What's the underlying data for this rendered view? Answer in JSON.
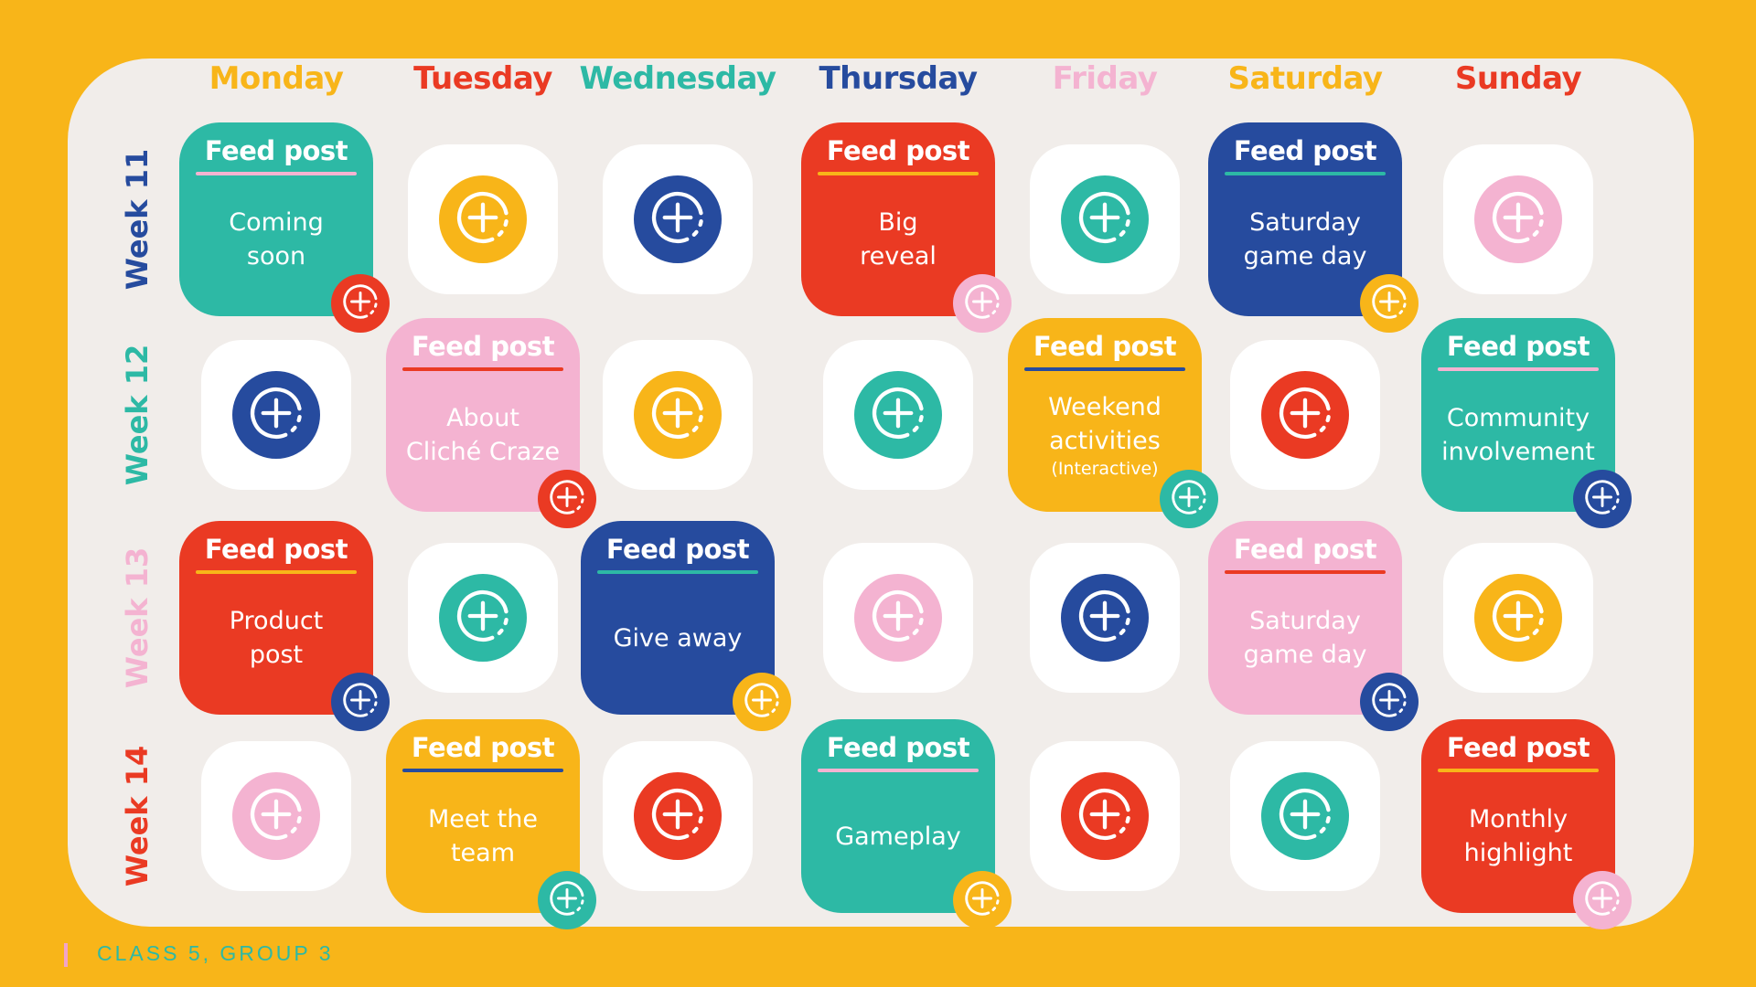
{
  "colors": {
    "yellow": "#F8B519",
    "red": "#EA3A23",
    "teal": "#2DB9A5",
    "navy": "#264B9E",
    "pink": "#F4B3D1",
    "board": "#F1EDEA"
  },
  "days": [
    {
      "label": "Monday",
      "color": "#F8B519"
    },
    {
      "label": "Tuesday",
      "color": "#EA3A23"
    },
    {
      "label": "Wednesday",
      "color": "#2DB9A5"
    },
    {
      "label": "Thursday",
      "color": "#264B9E"
    },
    {
      "label": "Friday",
      "color": "#F4B3D1"
    },
    {
      "label": "Saturday",
      "color": "#F8B519"
    },
    {
      "label": "Sunday",
      "color": "#EA3A23"
    }
  ],
  "weeks": [
    {
      "label": "Week 11",
      "color": "#264B9E"
    },
    {
      "label": "Week 12",
      "color": "#2DB9A5"
    },
    {
      "label": "Week 13",
      "color": "#F4B3D1"
    },
    {
      "label": "Week 14",
      "color": "#EA3A23"
    }
  ],
  "icon": "add-circle-icon",
  "grid": [
    [
      {
        "type": "post",
        "bg": "#2DB9A5",
        "rule": "#F4B3D1",
        "badge": "#EA3A23",
        "title": "Feed post",
        "text": "Coming\nsoon"
      },
      {
        "type": "empty",
        "circle": "#F8B519"
      },
      {
        "type": "empty",
        "circle": "#264B9E"
      },
      {
        "type": "post",
        "bg": "#EA3A23",
        "rule": "#F8B519",
        "badge": "#F4B3D1",
        "title": "Feed post",
        "text": "Big\nreveal"
      },
      {
        "type": "empty",
        "circle": "#2DB9A5"
      },
      {
        "type": "post",
        "bg": "#264B9E",
        "rule": "#2DB9A5",
        "badge": "#F8B519",
        "title": "Feed post",
        "text": "Saturday\ngame day"
      },
      {
        "type": "empty",
        "circle": "#F4B3D1"
      }
    ],
    [
      {
        "type": "empty",
        "circle": "#264B9E"
      },
      {
        "type": "post",
        "bg": "#F4B3D1",
        "rule": "#EA3A23",
        "badge": "#EA3A23",
        "title": "Feed post",
        "text": "About\nCliché Craze"
      },
      {
        "type": "empty",
        "circle": "#F8B519"
      },
      {
        "type": "empty",
        "circle": "#2DB9A5"
      },
      {
        "type": "post",
        "bg": "#F8B519",
        "rule": "#264B9E",
        "badge": "#2DB9A5",
        "title": "Feed post",
        "text": "Weekend\nactivities",
        "sub": "(Interactive)"
      },
      {
        "type": "empty",
        "circle": "#EA3A23"
      },
      {
        "type": "post",
        "bg": "#2DB9A5",
        "rule": "#F4B3D1",
        "badge": "#264B9E",
        "title": "Feed post",
        "text": "Community\ninvolvement"
      }
    ],
    [
      {
        "type": "post",
        "bg": "#EA3A23",
        "rule": "#F8B519",
        "badge": "#264B9E",
        "title": "Feed post",
        "text": "Product\npost"
      },
      {
        "type": "empty",
        "circle": "#2DB9A5"
      },
      {
        "type": "post",
        "bg": "#264B9E",
        "rule": "#2DB9A5",
        "badge": "#F8B519",
        "title": "Feed post",
        "text": "Give away"
      },
      {
        "type": "empty",
        "circle": "#F4B3D1"
      },
      {
        "type": "empty",
        "circle": "#264B9E"
      },
      {
        "type": "post",
        "bg": "#F4B3D1",
        "rule": "#EA3A23",
        "badge": "#264B9E",
        "title": "Feed post",
        "text": "Saturday\ngame day"
      },
      {
        "type": "empty",
        "circle": "#F8B519"
      }
    ],
    [
      {
        "type": "empty",
        "circle": "#F4B3D1"
      },
      {
        "type": "post",
        "bg": "#F8B519",
        "rule": "#264B9E",
        "badge": "#2DB9A5",
        "title": "Feed post",
        "text": "Meet the\nteam"
      },
      {
        "type": "empty",
        "circle": "#EA3A23"
      },
      {
        "type": "post",
        "bg": "#2DB9A5",
        "rule": "#F4B3D1",
        "badge": "#F8B519",
        "title": "Feed post",
        "text": "Gameplay"
      },
      {
        "type": "empty",
        "circle": "#EA3A23"
      },
      {
        "type": "empty",
        "circle": "#2DB9A5"
      },
      {
        "type": "post",
        "bg": "#EA3A23",
        "rule": "#F8B519",
        "badge": "#F4B3D1",
        "title": "Feed post",
        "text": "Monthly\nhighlight"
      }
    ]
  ],
  "footer": {
    "text": "CLASS 5, GROUP 3"
  }
}
